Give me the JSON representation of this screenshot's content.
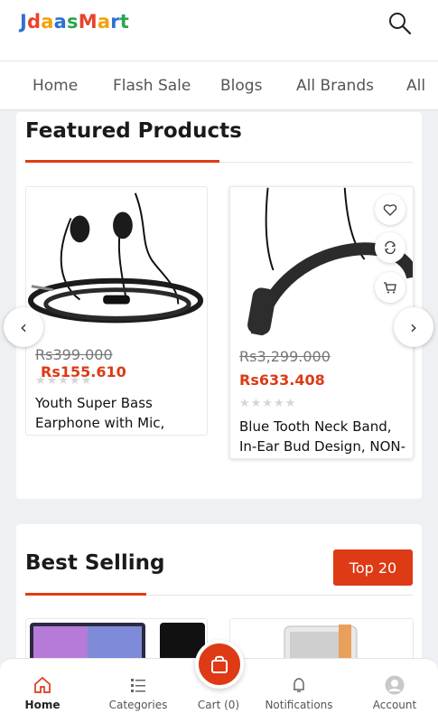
{
  "brand": {
    "letters": [
      {
        "ch": "J",
        "color": "#2f6fd6"
      },
      {
        "ch": "d",
        "color": "#e8432d"
      },
      {
        "ch": "a",
        "color": "#f2a20c"
      },
      {
        "ch": "a",
        "color": "#2f6fd6"
      },
      {
        "ch": "s",
        "color": "#2da44e"
      },
      {
        "ch": "M",
        "color": "#e8432d"
      },
      {
        "ch": "a",
        "color": "#f2a20c"
      },
      {
        "ch": "r",
        "color": "#2f6fd6"
      },
      {
        "ch": "t",
        "color": "#2da44e"
      }
    ]
  },
  "nav": {
    "items": [
      "Home",
      "Flash Sale",
      "Blogs",
      "All Brands",
      "All"
    ]
  },
  "featured": {
    "title": "Featured Products",
    "products": [
      {
        "old_price": "Rs399.000",
        "new_price": "Rs155.610",
        "name_line1": "Youth Super Bass",
        "name_line2": "Earphone with Mic,",
        "stars": "★★★★★"
      },
      {
        "old_price": "Rs3,299.000",
        "new_price": "Rs633.408",
        "name_line1": "Blue Tooth Neck Band,",
        "name_line2": "In-Ear Bud Design, NON-",
        "stars": "★★★★★"
      }
    ],
    "prev_glyph": "‹",
    "next_glyph": "›"
  },
  "best_selling": {
    "title": "Best Selling",
    "top_button": "Top 20"
  },
  "bottom_nav": {
    "home": "Home",
    "categories": "Categories",
    "cart": "Cart (0)",
    "notifications": "Notifications",
    "account": "Account"
  },
  "colors": {
    "accent": "#dd3a15"
  }
}
